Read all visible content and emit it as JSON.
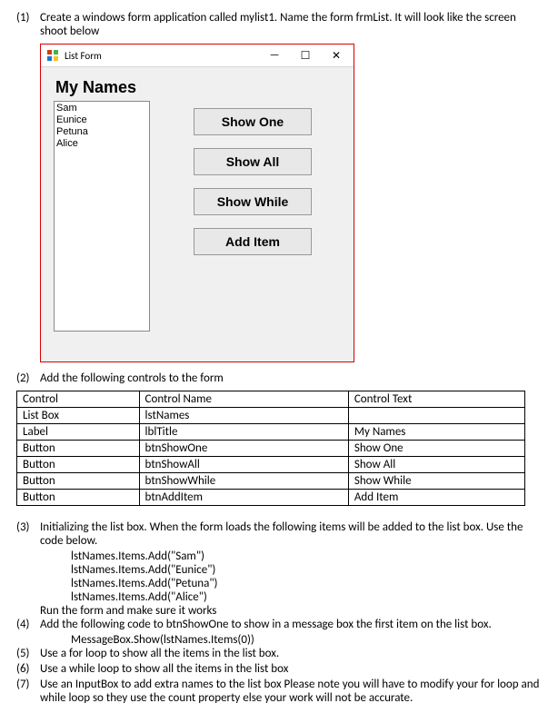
{
  "q1": {
    "num": "(1)",
    "text": "Create a windows form application called mylist1. Name the form frmList. It will look like the screen shoot below"
  },
  "form": {
    "title": "List Form",
    "heading": "My Names",
    "list_items": [
      "Sam",
      "Eunice",
      "Petuna",
      "Alice"
    ],
    "btn_show_one": "Show One",
    "btn_show_all": "Show All",
    "btn_show_while": "Show While",
    "btn_add_item": "Add Item",
    "min": "—",
    "max": "☐",
    "close": "✕"
  },
  "q2": {
    "num": "(2)",
    "text": "Add the following controls to the form"
  },
  "table": {
    "headers": [
      "Control",
      "Control Name",
      "Control Text"
    ],
    "rows": [
      [
        "List Box",
        "lstNames",
        ""
      ],
      [
        "Label",
        "lblTitle",
        "My Names"
      ],
      [
        "Button",
        "btnShowOne",
        "Show One"
      ],
      [
        "Button",
        "btnShowAll",
        "Show All"
      ],
      [
        "Button",
        "btnShowWhile",
        "Show While"
      ],
      [
        "Button",
        "btnAddItem",
        "Add Item"
      ]
    ]
  },
  "q3": {
    "num": "(3)",
    "text": "Initializing the list box. When the form loads the following items will be added to the list box. Use the code below.",
    "code": [
      "lstNames.Items.Add(\"Sam\")",
      "lstNames.Items.Add(\"Eunice\")",
      "lstNames.Items.Add(\"Petuna\")",
      "lstNames.Items.Add(\"Alice\")"
    ],
    "after": "Run the form and make sure it works"
  },
  "q4": {
    "num": "(4)",
    "text": "Add the following code to btnShowOne to show in a message box the first item on the list box.",
    "code": "MessageBox.Show(lstNames.Items(0))"
  },
  "q5": {
    "num": "(5)",
    "text": "Use a for loop to show all the items in the list box."
  },
  "q6": {
    "num": "(6)",
    "text": "Use a while loop to show all the items in the list box"
  },
  "q7": {
    "num": "(7)",
    "text": "Use an InputBox to add extra names to the list box Please note you will have to modify your for loop and while loop so they use the count property else your work will not be accurate."
  }
}
